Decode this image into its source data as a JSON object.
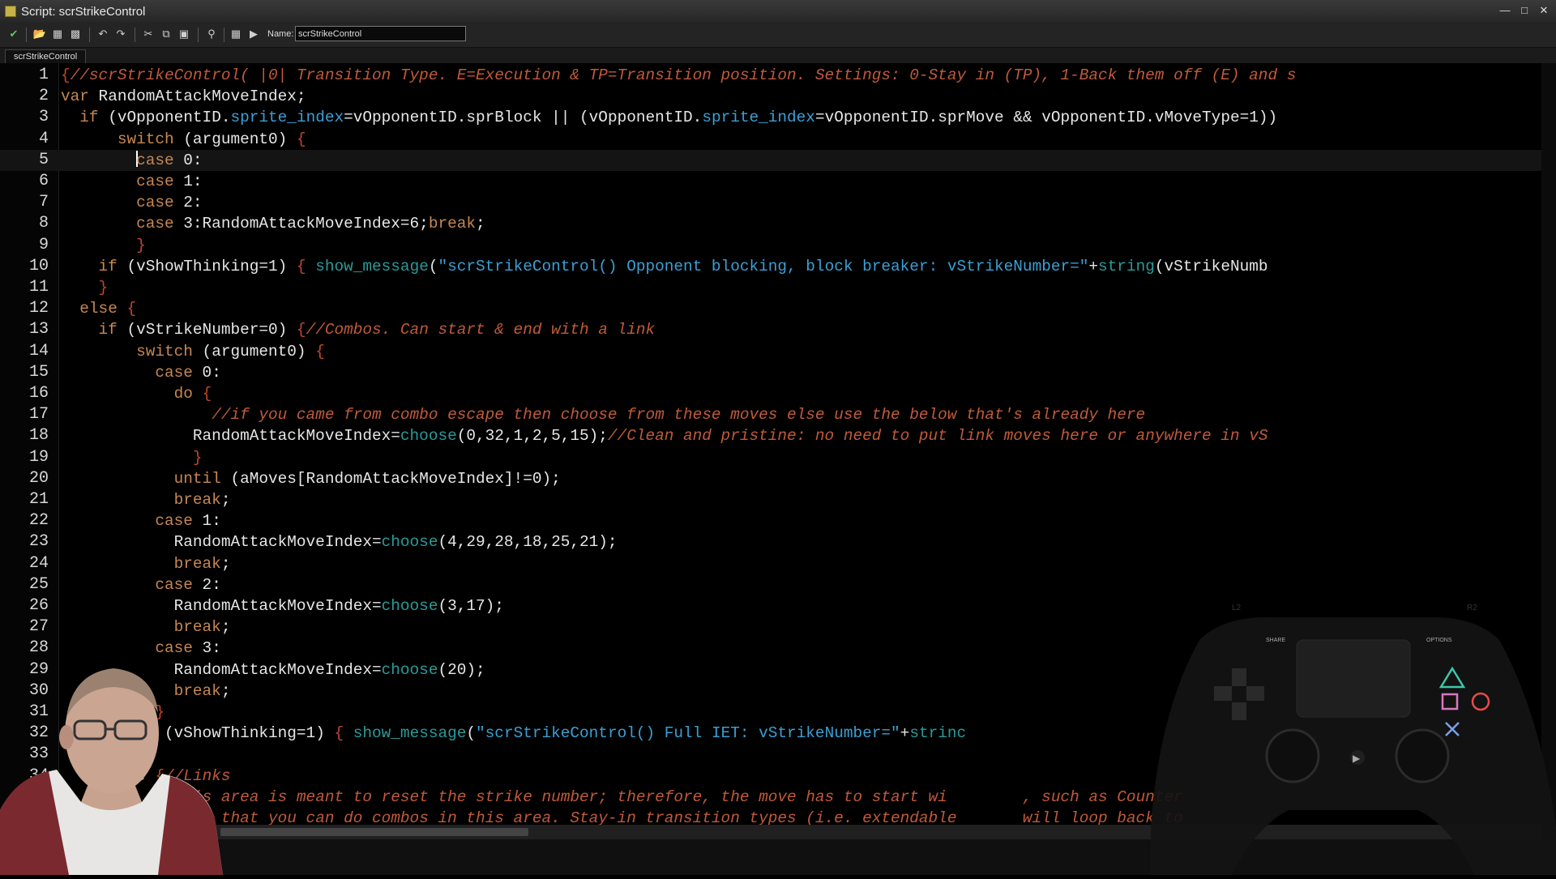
{
  "window": {
    "title": "Script: scrStrikeControl"
  },
  "toolbar": {
    "name_label": "Name:",
    "name_value": "scrStrikeControl"
  },
  "tab": {
    "label": "scrStrikeControl"
  },
  "editor": {
    "current_line": 5,
    "lines": [
      {
        "n": "1",
        "t": "{//scrStrikeControl( |0| Transition Type. E=Execution & TP=Transition position. Settings: 0-Stay in (TP), 1-Back them off (E) and s"
      },
      {
        "n": "2",
        "t": "var RandomAttackMoveIndex;"
      },
      {
        "n": "3",
        "t": "  if (vOpponentID.sprite_index=vOpponentID.sprBlock || (vOpponentID.sprite_index=vOpponentID.sprMove && vOpponentID.vMoveType=1))"
      },
      {
        "n": "4",
        "t": "      switch (argument0) {"
      },
      {
        "n": "5",
        "t": "        case 0:"
      },
      {
        "n": "6",
        "t": "        case 1:"
      },
      {
        "n": "7",
        "t": "        case 2:"
      },
      {
        "n": "8",
        "t": "        case 3:RandomAttackMoveIndex=6;break;"
      },
      {
        "n": "9",
        "t": "        }"
      },
      {
        "n": "10",
        "t": "    if (vShowThinking=1) { show_message(\"scrStrikeControl() Opponent blocking, block breaker: vStrikeNumber=\"+string(vStrikeNumb"
      },
      {
        "n": "11",
        "t": "    }"
      },
      {
        "n": "12",
        "t": "  else {"
      },
      {
        "n": "13",
        "t": "    if (vStrikeNumber=0) {//Combos. Can start & end with a link"
      },
      {
        "n": "14",
        "t": "        switch (argument0) {"
      },
      {
        "n": "15",
        "t": "          case 0:"
      },
      {
        "n": "16",
        "t": "            do {"
      },
      {
        "n": "17",
        "t": "                //if you came from combo escape then choose from these moves else use the below that's already here"
      },
      {
        "n": "18",
        "t": "              RandomAttackMoveIndex=choose(0,32,1,2,5,15);//Clean and pristine: no need to put link moves here or anywhere in vS"
      },
      {
        "n": "19",
        "t": "              }"
      },
      {
        "n": "20",
        "t": "            until (aMoves[RandomAttackMoveIndex]!=0);"
      },
      {
        "n": "21",
        "t": "            break;"
      },
      {
        "n": "22",
        "t": "          case 1:"
      },
      {
        "n": "23",
        "t": "            RandomAttackMoveIndex=choose(4,29,28,18,25,21);"
      },
      {
        "n": "24",
        "t": "            break;"
      },
      {
        "n": "25",
        "t": "          case 2:"
      },
      {
        "n": "26",
        "t": "            RandomAttackMoveIndex=choose(3,17);"
      },
      {
        "n": "27",
        "t": "            break;"
      },
      {
        "n": "28",
        "t": "          case 3:"
      },
      {
        "n": "29",
        "t": "            RandomAttackMoveIndex=choose(20);"
      },
      {
        "n": "30",
        "t": "            break;"
      },
      {
        "n": "31",
        "t": "          }"
      },
      {
        "n": "32",
        "t": "        if (vShowThinking=1) { show_message(\"scrStrikeControl() Full IET: vStrikeNumber=\"+strinc"
      },
      {
        "n": "33",
        "t": "        }"
      },
      {
        "n": "34",
        "t": "      lse {//Links"
      },
      {
        "n": "35",
        "t": "          //This area is meant to reset the strike number; therefore, the move has to start wi        , such as Counter"
      },
      {
        "n": "",
        "t": "          //Note that you can do combos in this area. Stay-in transition types (i.e. extendable       will loop back to"
      }
    ]
  },
  "controller": {
    "share_label": "SHARE",
    "options_label": "OPTIONS",
    "l2_label": "L2",
    "r2_label": "R2"
  },
  "colors": {
    "keyword": "#c78752",
    "comment": "#c05a3a",
    "string": "#3b9fd4",
    "function": "#2a9a9a",
    "text": "#e6e6e6"
  }
}
